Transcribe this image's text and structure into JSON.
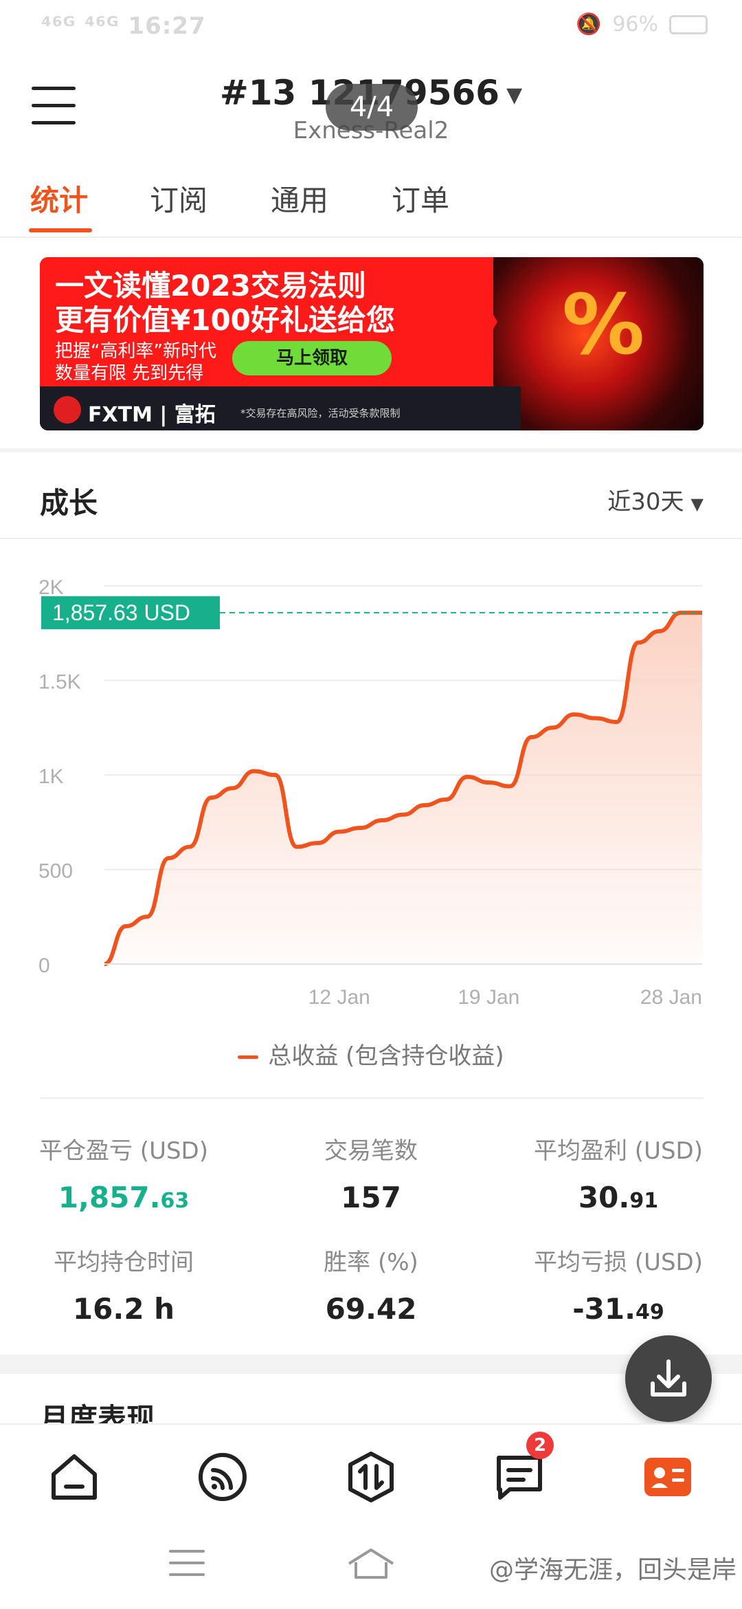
{
  "status": {
    "time": "16:27",
    "battery": "96%",
    "signal_left": "⁴⁶ᴳ ⁴⁶ᴳ"
  },
  "header": {
    "account": "#13 12179566",
    "server": "Exness-Real2",
    "page_indicator": "4/4"
  },
  "tabs": [
    "统计",
    "订阅",
    "通用",
    "订单"
  ],
  "banner": {
    "headline1": "一文读懂2023交易法则",
    "headline2": "更有价值¥100好礼送给您",
    "sub1": "把握“高利率”新时代",
    "sub2": "数量有限 先到先得",
    "cta": "马上领取",
    "brand": "FXTM | 富拓",
    "disclaimer": "*交易存在高风险，活动受条款限制",
    "art_text": "%"
  },
  "growth": {
    "title": "成长",
    "range": "近30天"
  },
  "chart_data": {
    "type": "area",
    "x": [
      "Jan 1",
      "Jan 2",
      "Jan 3",
      "Jan 4",
      "Jan 5",
      "Jan 6",
      "Jan 7",
      "Jan 8",
      "Jan 9",
      "Jan 10",
      "Jan 11",
      "Jan 12",
      "Jan 13",
      "Jan 14",
      "Jan 15",
      "Jan 16",
      "Jan 17",
      "Jan 18",
      "Jan 19",
      "Jan 20",
      "Jan 21",
      "Jan 22",
      "Jan 23",
      "Jan 24",
      "Jan 25",
      "Jan 26",
      "Jan 27",
      "Jan 28",
      "Jan 29"
    ],
    "values": [
      0,
      200,
      250,
      560,
      620,
      880,
      930,
      1020,
      1000,
      620,
      640,
      700,
      720,
      760,
      790,
      840,
      870,
      990,
      960,
      940,
      1200,
      1250,
      1320,
      1300,
      1280,
      1700,
      1760,
      1857.63,
      1857.63
    ],
    "ylim": [
      0,
      2000
    ],
    "yticks": [
      "0",
      "500",
      "1K",
      "1.5K",
      "2K"
    ],
    "xtick_labels": [
      "12 Jan",
      "19 Jan",
      "28 Jan"
    ],
    "current_value_label": "1,857.63 USD",
    "legend": "总收益 (包含持仓收益)",
    "line_color": "#f0541e",
    "fill_color": "#fbd3c4"
  },
  "stats": [
    {
      "label": "平仓盈亏 (USD)",
      "value_main": "1,857.",
      "value_small": "63",
      "color": "green"
    },
    {
      "label": "交易笔数",
      "value_main": "157",
      "value_small": ""
    },
    {
      "label": "平均盈利 (USD)",
      "value_main": "30.",
      "value_small": "91"
    },
    {
      "label": "平均持仓时间",
      "value_main": "16.2 h",
      "value_small": ""
    },
    {
      "label": "胜率 (%)",
      "value_main": "69.42",
      "value_small": ""
    },
    {
      "label": "平均亏损 (USD)",
      "value_main": "-31.",
      "value_small": "49"
    }
  ],
  "monthly": {
    "title": "月度表现"
  },
  "bottom_nav": {
    "items": [
      "home-icon",
      "feed-icon",
      "trade-icon",
      "messages-icon",
      "profile-icon"
    ],
    "badge": "2"
  },
  "watermark": "@学海无涯，回头是岸",
  "colors": {
    "accent": "#f0541e",
    "green": "#16b08c"
  }
}
